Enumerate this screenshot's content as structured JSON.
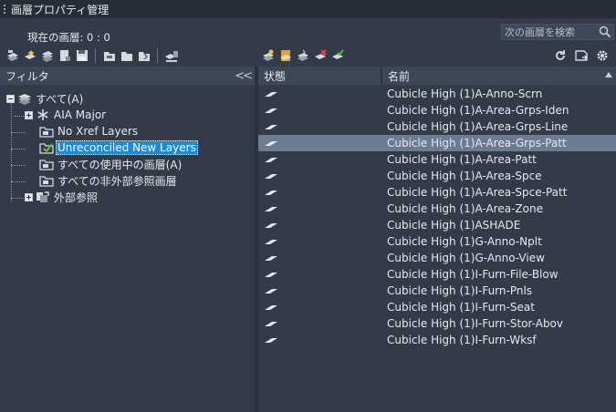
{
  "window": {
    "title": "画層プロパティ管理"
  },
  "current_layer": {
    "label": "現在の画層: 0 : 0"
  },
  "search": {
    "placeholder": "次の画層を検索"
  },
  "filter_panel": {
    "header": "フィルタ",
    "tree": [
      {
        "label": "すべて(A)",
        "icon": "layer-stack-icon",
        "expander": "−",
        "selected": false
      },
      {
        "label": "AIA Major",
        "icon": "snowflake-filter-icon",
        "expander": "+",
        "selected": false
      },
      {
        "label": "No Xref Layers",
        "icon": "filter-folder-icon",
        "selected": false
      },
      {
        "label": "Unreconciled New Layers",
        "icon": "filter-folder-check-icon",
        "selected": true
      },
      {
        "label": "すべての使用中の画層(A)",
        "icon": "filter-folder-icon",
        "selected": false
      },
      {
        "label": "すべての非外部参照画層",
        "icon": "filter-folder-icon",
        "selected": false
      },
      {
        "label": "外部参照",
        "icon": "xref-icon",
        "expander": "+",
        "selected": false
      }
    ]
  },
  "layer_list": {
    "columns": {
      "state": "状態",
      "name": "名前"
    },
    "rows": [
      {
        "name": "Cubicle High (1)A-Anno-Scrn",
        "state_icon": "layer-state-icon"
      },
      {
        "name": "Cubicle High (1)A-Area-Grps-Iden",
        "state_icon": "layer-state-icon"
      },
      {
        "name": "Cubicle High (1)A-Area-Grps-Line",
        "state_icon": "layer-state-icon"
      },
      {
        "name": "Cubicle High (1)A-Area-Grps-Patt",
        "state_icon": "layer-state-icon",
        "selected": true
      },
      {
        "name": "Cubicle High (1)A-Area-Patt",
        "state_icon": "layer-state-icon"
      },
      {
        "name": "Cubicle High (1)A-Area-Spce",
        "state_icon": "layer-state-icon"
      },
      {
        "name": "Cubicle High (1)A-Area-Spce-Patt",
        "state_icon": "layer-state-icon"
      },
      {
        "name": "Cubicle High (1)A-Area-Zone",
        "state_icon": "layer-state-icon"
      },
      {
        "name": "Cubicle High (1)ASHADE",
        "state_icon": "layer-state-icon"
      },
      {
        "name": "Cubicle High (1)G-Anno-Nplt",
        "state_icon": "layer-state-icon"
      },
      {
        "name": "Cubicle High (1)G-Anno-View",
        "state_icon": "layer-state-icon"
      },
      {
        "name": "Cubicle High (1)I-Furn-File-Blow",
        "state_icon": "layer-state-icon"
      },
      {
        "name": "Cubicle High (1)I-Furn-Pnls",
        "state_icon": "layer-state-icon"
      },
      {
        "name": "Cubicle High (1)I-Furn-Seat",
        "state_icon": "layer-state-icon"
      },
      {
        "name": "Cubicle High (1)I-Furn-Stor-Abov",
        "state_icon": "layer-state-icon"
      },
      {
        "name": "Cubicle High (1)I-Furn-Wksf",
        "state_icon": "layer-state-icon"
      }
    ]
  },
  "colors": {
    "background": "#333b48",
    "header": "#3e4755",
    "titlebar": "#262d37",
    "selection_tree": "#1e8ad6",
    "selection_row": "#6b7c93"
  }
}
